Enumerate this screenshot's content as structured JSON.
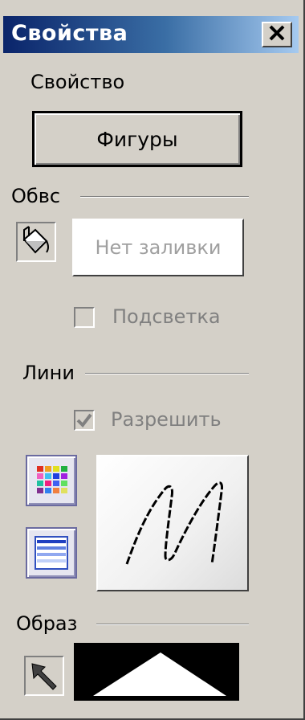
{
  "window": {
    "title": "Свойства",
    "close_label": "✕"
  },
  "property": {
    "label": "Свойство",
    "button_label": "Фигуры"
  },
  "fill_group": {
    "title": "Обвс",
    "fill_button_label": "Нет заливки",
    "highlight_label": "Подсветка",
    "highlight_checked": false
  },
  "lines_group": {
    "title": "Лини",
    "enable_label": "Разрешить",
    "enable_checked": true
  },
  "image_group": {
    "title": "Образ"
  },
  "icons": [
    "close-icon",
    "paint-bucket-icon",
    "color-palette-icon",
    "line-style-icon",
    "stroke-preview-icon",
    "arrow-pointer-icon",
    "triangle-preview-icon"
  ],
  "colors": {
    "titlebar_start": "#0a246a",
    "titlebar_end": "#a6caf0",
    "face": "#d4d0c8",
    "disabled_text": "#808080"
  }
}
